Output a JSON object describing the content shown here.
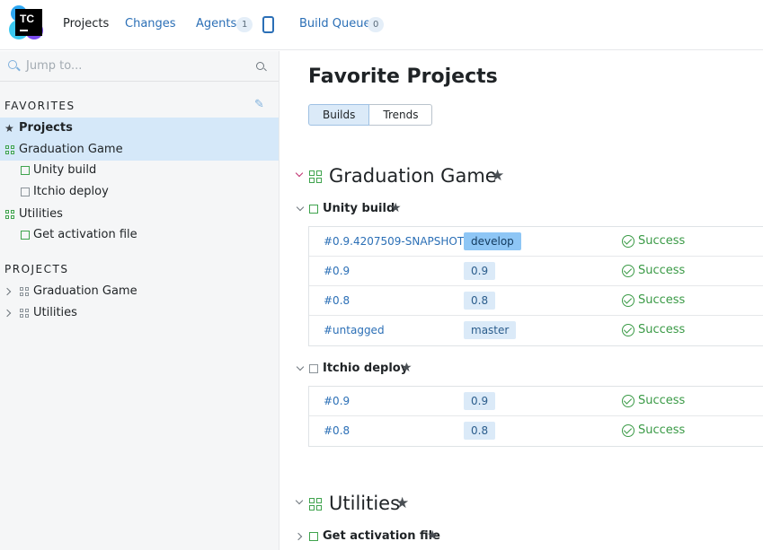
{
  "app": {
    "logo_text": "TC"
  },
  "topnav": {
    "items": [
      {
        "label": "Projects",
        "active": true
      },
      {
        "label": "Changes"
      },
      {
        "label": "Agents",
        "count": "1"
      },
      {
        "label": "Build Queue",
        "count": "0"
      }
    ]
  },
  "sidebar": {
    "search_placeholder": "Jump to...",
    "favorites_title": "FAVORITES",
    "favorites": [
      {
        "label": "Projects",
        "icon": "star-icon",
        "selected": true
      },
      {
        "label": "Graduation Game",
        "icon": "project-grid-icon"
      },
      {
        "label": "Unity build",
        "icon": "build-config-icon"
      },
      {
        "label": "Itchio deploy",
        "icon": "build-config-icon"
      },
      {
        "label": "Utilities",
        "icon": "project-grid-icon"
      },
      {
        "label": "Get activation file",
        "icon": "build-config-icon"
      }
    ],
    "projects_title": "PROJECTS",
    "projects": [
      {
        "label": "Graduation Game"
      },
      {
        "label": "Utilities"
      }
    ]
  },
  "main": {
    "title": "Favorite Projects",
    "tabs": [
      {
        "label": "Builds",
        "active": true
      },
      {
        "label": "Trends"
      }
    ],
    "projects": [
      {
        "name": "Graduation Game",
        "build_types": [
          {
            "name": "Unity build",
            "builds": [
              {
                "number": "#0.9.4207509-SNAPSHOT",
                "branch": "develop",
                "default": true,
                "status": "Success"
              },
              {
                "number": "#0.9",
                "branch": "0.9",
                "status": "Success"
              },
              {
                "number": "#0.8",
                "branch": "0.8",
                "status": "Success"
              },
              {
                "number": "#untagged",
                "branch": "master",
                "status": "Success"
              }
            ]
          },
          {
            "name": "Itchio deploy",
            "builds": [
              {
                "number": "#0.9",
                "branch": "0.9",
                "status": "Success"
              },
              {
                "number": "#0.8",
                "branch": "0.8",
                "status": "Success"
              }
            ]
          }
        ]
      },
      {
        "name": "Utilities",
        "build_types": [
          {
            "name": "Get activation file"
          }
        ]
      }
    ]
  },
  "colors": {
    "accent": "#2b6fb6",
    "success": "#3a9a46",
    "selection": "#d5e8f9"
  }
}
